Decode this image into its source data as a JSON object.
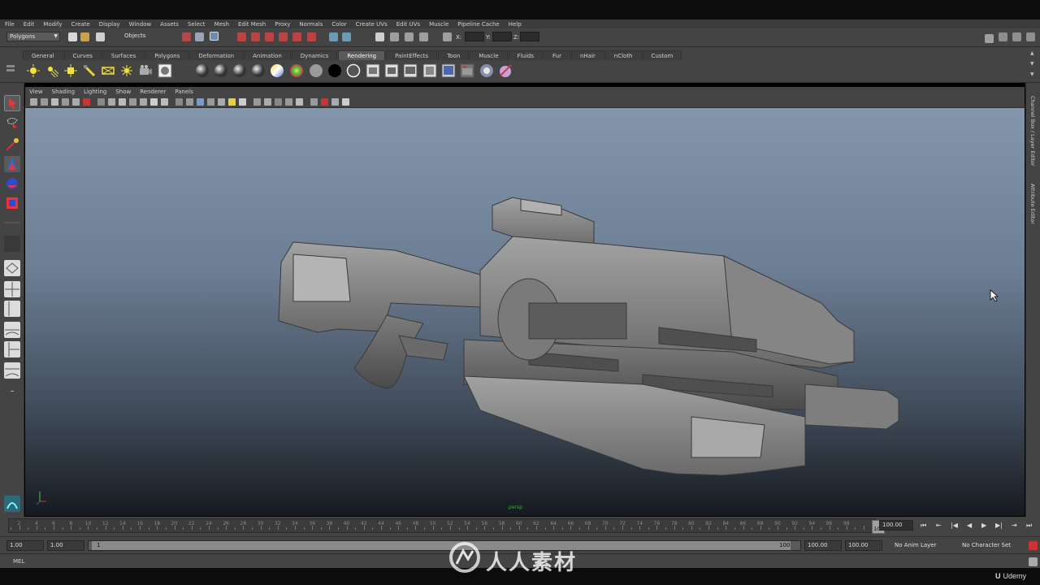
{
  "menu": [
    "File",
    "Edit",
    "Modify",
    "Create",
    "Display",
    "Window",
    "Assets",
    "Select",
    "Mesh",
    "Edit Mesh",
    "Proxy",
    "Normals",
    "Color",
    "Create UVs",
    "Edit UVs",
    "Muscle",
    "Pipeline Cache",
    "Help"
  ],
  "status_line": {
    "menu_set": "Polygons",
    "selection_mode": "Objects",
    "x_label": "X:",
    "y_label": "Y:",
    "z_label": "Z:"
  },
  "shelf": {
    "tabs": [
      "General",
      "Curves",
      "Surfaces",
      "Polygons",
      "Deformation",
      "Animation",
      "Dynamics",
      "Rendering",
      "PaintEffects",
      "Toon",
      "Muscle",
      "Fluids",
      "Fur",
      "nHair",
      "nCloth",
      "Custom"
    ],
    "active_tab": "Rendering"
  },
  "panel": {
    "menu": [
      "View",
      "Shading",
      "Lighting",
      "Show",
      "Renderer",
      "Panels"
    ],
    "camera_label": "persp"
  },
  "right_panel": {
    "channel_box_tab": "Channel Box / Layer Editor",
    "attribute_editor_tab": "Attribute Editor"
  },
  "time_slider": {
    "ticks": [
      "2",
      "4",
      "6",
      "8",
      "10",
      "12",
      "14",
      "16",
      "18",
      "20",
      "22",
      "24",
      "26",
      "28",
      "30",
      "32",
      "34",
      "36",
      "38",
      "40",
      "42",
      "44",
      "46",
      "48",
      "50",
      "52",
      "54",
      "56",
      "58",
      "60",
      "62",
      "64",
      "66",
      "68",
      "70",
      "72",
      "74",
      "76",
      "78",
      "80",
      "82",
      "84",
      "86",
      "88",
      "90",
      "92",
      "94",
      "96",
      "98"
    ],
    "current_frame": "100",
    "current_time_field": "100.00"
  },
  "range_slider": {
    "start_time": "1.00",
    "playback_start": "1.00",
    "range_start_label": "1",
    "range_end_label": "100",
    "playback_end": "100.00",
    "end_time": "100.00",
    "anim_layer": "No Anim Layer",
    "character_set": "No Character Set"
  },
  "command_line": {
    "language": "MEL"
  },
  "branding": {
    "udemy": "Udemy",
    "watermark_text": "人人素材"
  },
  "colors": {
    "ui_gray": "#444444",
    "viewport_top": "#8496ac",
    "viewport_bottom": "#161a1f",
    "model_gray": "#8a8a8a"
  }
}
